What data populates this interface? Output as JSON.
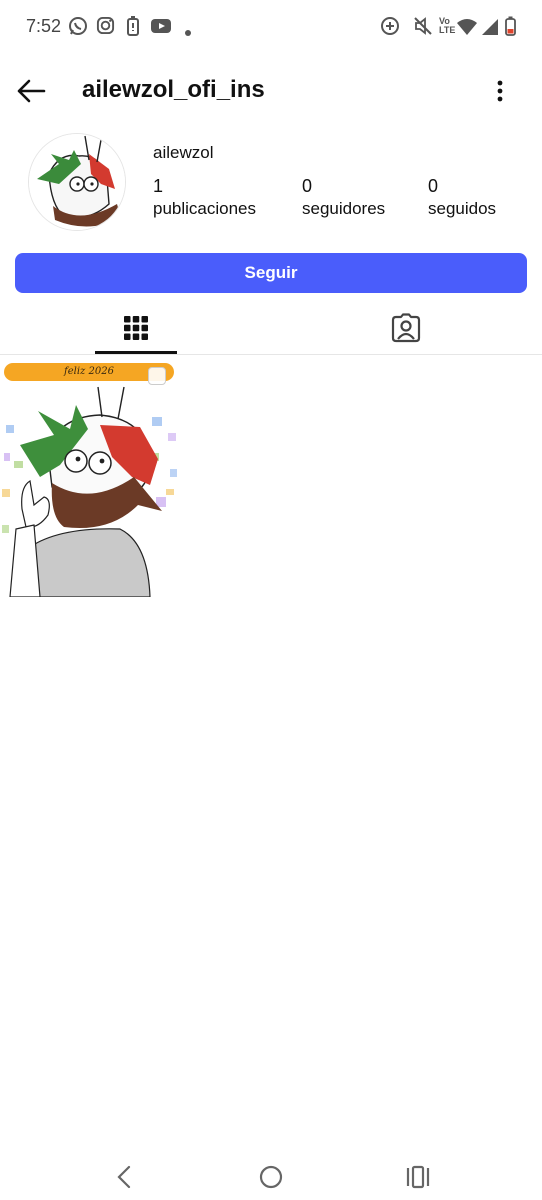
{
  "status_bar": {
    "time": "7:52",
    "left_icons": [
      "whatsapp-icon",
      "instagram-icon",
      "battery-saver-icon",
      "youtube-icon",
      "dot-icon"
    ],
    "right_icons": [
      "data-saver-icon",
      "mute-icon",
      "volte-icon",
      "wifi-icon",
      "signal-icon",
      "battery-icon"
    ],
    "volte_label_top": "Vo",
    "volte_label_bottom": "LTE"
  },
  "header": {
    "username": "ailewzol_ofi_ins",
    "back_icon": "arrow-left-icon",
    "menu_icon": "more-vertical-icon"
  },
  "profile": {
    "display_name": "ailewzol",
    "stats": [
      {
        "value": "1",
        "label": "publicaciones"
      },
      {
        "value": "0",
        "label": "seguidores"
      },
      {
        "value": "0",
        "label": "seguidos"
      }
    ]
  },
  "follow_button": {
    "label": "Seguir",
    "color": "#4a5dfb"
  },
  "tabs": [
    {
      "icon": "grid-icon",
      "active": true
    },
    {
      "icon": "tagged-person-icon",
      "active": false
    }
  ],
  "posts": [
    {
      "banner_text": "feliz 2026",
      "multi_icon": "carousel-icon"
    }
  ],
  "nav_bar": {
    "icons": [
      "nav-back-icon",
      "nav-home-icon",
      "nav-recents-icon"
    ]
  }
}
